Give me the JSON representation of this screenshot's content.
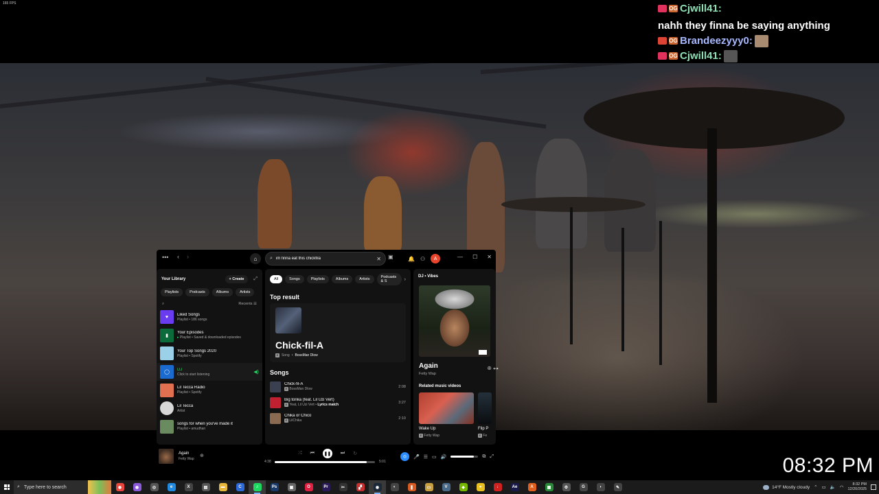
{
  "overlay": {
    "fps_text": "165 FPS",
    "clock": "08:32 PM",
    "chat": [
      {
        "user": "Cjwill41",
        "user_color": "#8fe0b4",
        "badges": [
          "heart",
          "og"
        ],
        "message": "nahh they finna be saying anything",
        "emote": null
      },
      {
        "user": "Brandeezyyy0",
        "user_color": "#a8b8ff",
        "badges": [
          "rocket",
          "og"
        ],
        "message": "",
        "emote": "face-emote"
      },
      {
        "user": "Cjwill41",
        "user_color": "#8fe0b4",
        "badges": [
          "heart",
          "og"
        ],
        "message": "",
        "emote": "rocket-emote"
      }
    ]
  },
  "spotify": {
    "topbar": {
      "search_value": "im finna eat this chickfila",
      "avatar_letter": "A"
    },
    "library": {
      "title": "Your Library",
      "create_label": "Create",
      "filters": [
        "Playlists",
        "Podcasts",
        "Albums",
        "Artists"
      ],
      "sort_label": "Recents",
      "items": [
        {
          "title": "Liked Songs",
          "sub": "Playlist • 186 songs",
          "thumb_color": "#6a3cf0",
          "icon": "♥",
          "round": false,
          "green": false,
          "playing": false
        },
        {
          "title": "Your Episodes",
          "sub": "Playlist • Saved & downloaded episodes",
          "thumb_color": "#0b6b3a",
          "icon": "▮",
          "round": false,
          "green": false,
          "playing": false
        },
        {
          "title": "Your Top Songs 2020",
          "sub": "Playlist • Spotify",
          "thumb_color": "#9ad0e8",
          "icon": "",
          "round": false,
          "green": false,
          "playing": false
        },
        {
          "title": "DJ",
          "sub": "Click to start listening",
          "thumb_color": "#1a6ad0",
          "icon": "◯",
          "round": false,
          "green": true,
          "playing": true
        },
        {
          "title": "Lil Tecca Radio",
          "sub": "Playlist • Spotify",
          "thumb_color": "#e07050",
          "icon": "",
          "round": false,
          "green": false,
          "playing": false
        },
        {
          "title": "Lil Tecca",
          "sub": "Artist",
          "thumb_color": "#d8d8d8",
          "icon": "",
          "round": true,
          "green": false,
          "playing": false
        },
        {
          "title": "songs for when you've made it",
          "sub": "Playlist • amudhan",
          "thumb_color": "#6a8a60",
          "icon": "",
          "round": false,
          "green": false,
          "playing": false
        }
      ]
    },
    "main": {
      "tabs": [
        "All",
        "Songs",
        "Playlists",
        "Albums",
        "Artists",
        "Podcasts & S"
      ],
      "active_tab": "All",
      "top_result_heading": "Top result",
      "top_result": {
        "name": "Chick-fil-A",
        "type": "Song",
        "artist": "BossMan Dlow"
      },
      "songs_heading": "Songs",
      "songs": [
        {
          "title": "Chick-fil-A",
          "artists": "BossMan Dlow",
          "extra": "",
          "duration": "2:08",
          "thumb_color": "#3a4050"
        },
        {
          "title": "Big tonka (feat. Lil Uzi Vert)",
          "artists": "Yeat, Lil Uzi Vert",
          "extra": "Lyrics match",
          "duration": "3:27",
          "thumb_color": "#c02030"
        },
        {
          "title": "Chika or Chico",
          "artists": "LilChika",
          "extra": "",
          "duration": "2:10",
          "thumb_color": "#8a6a50"
        }
      ]
    },
    "right_panel": {
      "context": "DJ • Vibes",
      "song_title": "Again",
      "artist": "Fetty Wap",
      "related_heading": "Related music videos",
      "videos": [
        {
          "title": "Wake Up",
          "artist": "Fetty Wap"
        },
        {
          "title": "Flip P",
          "artist": "Fe"
        }
      ]
    },
    "player": {
      "title": "Again",
      "artist": "Fetty Wap",
      "elapsed": "4:38",
      "duration": "5:01",
      "progress_fraction": 0.92,
      "volume_fraction": 0.85
    }
  },
  "taskbar": {
    "search_placeholder": "Type here to search",
    "weather": "14°F  Mostly cloudy",
    "time": "8:32 PM",
    "date": "12/20/2025",
    "apps": [
      {
        "name": "chrome",
        "color": "#e8453c",
        "glyph": "◉",
        "active": false
      },
      {
        "name": "chrome-profile",
        "color": "#8a5ad8",
        "glyph": "◉",
        "active": false
      },
      {
        "name": "steam-alt",
        "color": "#555",
        "glyph": "◎",
        "active": false
      },
      {
        "name": "edge",
        "color": "#1f8ae0",
        "glyph": "e",
        "active": false
      },
      {
        "name": "xbox",
        "color": "#444",
        "glyph": "X",
        "active": false
      },
      {
        "name": "media",
        "color": "#555",
        "glyph": "▤",
        "active": false
      },
      {
        "name": "file-explorer",
        "color": "#e8b83c",
        "glyph": "▬",
        "active": false
      },
      {
        "name": "ccleaner",
        "color": "#2d6ad8",
        "glyph": "C",
        "active": false
      },
      {
        "name": "spotify",
        "color": "#1ed760",
        "glyph": "♫",
        "active": true
      },
      {
        "name": "photoshop",
        "color": "#1a3a6a",
        "glyph": "Ps",
        "active": false
      },
      {
        "name": "app-box",
        "color": "#666",
        "glyph": "▣",
        "active": false
      },
      {
        "name": "opera",
        "color": "#e02040",
        "glyph": "O",
        "active": false
      },
      {
        "name": "premiere",
        "color": "#2a1a5a",
        "glyph": "Pr",
        "active": false
      },
      {
        "name": "capcut",
        "color": "#333",
        "glyph": "✂",
        "active": false
      },
      {
        "name": "roblox",
        "color": "#c83030",
        "glyph": "▞",
        "active": false
      },
      {
        "name": "steam",
        "color": "#1b2838",
        "glyph": "◉",
        "active": true
      },
      {
        "name": "obs",
        "color": "#444",
        "glyph": "◐",
        "active": false
      },
      {
        "name": "audacity",
        "color": "#d85a20",
        "glyph": "❚",
        "active": false
      },
      {
        "name": "files",
        "color": "#c8a040",
        "glyph": "▭",
        "active": false
      },
      {
        "name": "vpn",
        "color": "#4a6a8a",
        "glyph": "V",
        "active": false
      },
      {
        "name": "nvidia",
        "color": "#76b900",
        "glyph": "◆",
        "active": false
      },
      {
        "name": "app-yellow",
        "color": "#e8c020",
        "glyph": "●",
        "active": false
      },
      {
        "name": "download",
        "color": "#d02020",
        "glyph": "↓",
        "active": false
      },
      {
        "name": "after-effects",
        "color": "#1a1a4a",
        "glyph": "Ae",
        "active": false
      },
      {
        "name": "app-orange",
        "color": "#e06020",
        "glyph": "A",
        "active": false
      },
      {
        "name": "calendar",
        "color": "#2a8a3a",
        "glyph": "▦",
        "active": false
      },
      {
        "name": "settings",
        "color": "#555",
        "glyph": "⚙",
        "active": false
      },
      {
        "name": "app-g",
        "color": "#444",
        "glyph": "G",
        "active": false
      },
      {
        "name": "app-shield",
        "color": "#444",
        "glyph": "◗",
        "active": false
      },
      {
        "name": "pen",
        "color": "#444",
        "glyph": "✎",
        "active": false
      }
    ]
  },
  "colors": {
    "spotify_green": "#1ed760",
    "chat_green": "#8fe0b4",
    "chat_blue": "#a8b8ff"
  }
}
